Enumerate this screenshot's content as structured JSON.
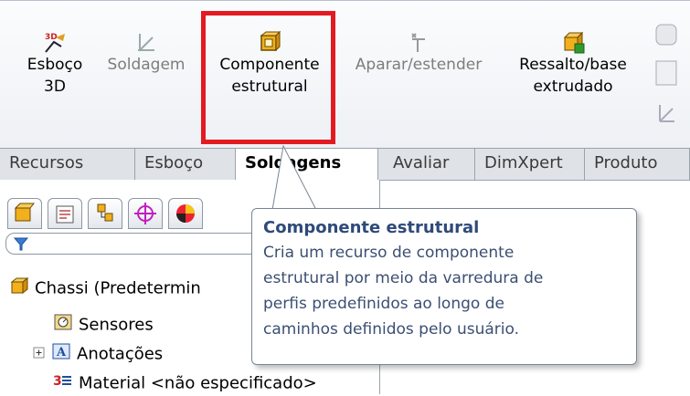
{
  "toolbar": {
    "items": [
      {
        "label": "Esboço\n3D",
        "icon": "sketch-3d-icon",
        "enabled": true
      },
      {
        "label": "Soldagem",
        "icon": "weldment-icon",
        "enabled": false
      },
      {
        "label": "Componente\nestrutural",
        "icon": "structural-member-icon",
        "enabled": true
      },
      {
        "label": "Aparar/estender",
        "icon": "trim-extend-icon",
        "enabled": false
      },
      {
        "label": "Ressalto/base\nextrudado",
        "icon": "extruded-boss-icon",
        "enabled": true
      }
    ]
  },
  "command_tabs": [
    "Recursos",
    "Esboço",
    "Soldagens",
    "Avaliar",
    "DimXpert",
    "Produto"
  ],
  "active_tab": "Soldagens",
  "tree": {
    "root": "Chassi  (Predetermin",
    "items": [
      "Sensores",
      "Anotações",
      "Material <não especificado>"
    ]
  },
  "tooltip": {
    "title": "Componente estrutural",
    "body": "Cria um recurso de componente\nestrutural por meio da varredura de\nperfis predefinidos ao longo de\ncaminhos definidos pelo usuário."
  },
  "colors": {
    "highlight": "#e21b22",
    "tooltip_text": "#3b4f73"
  }
}
